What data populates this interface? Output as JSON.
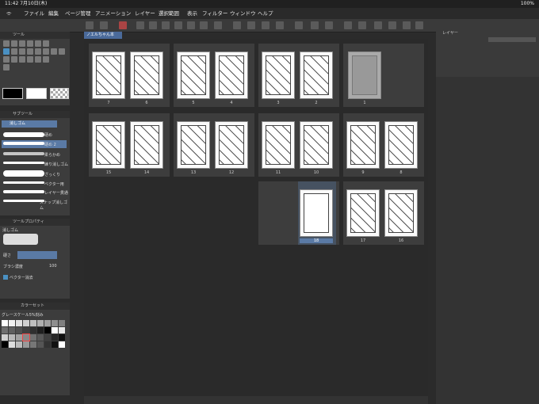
{
  "status": {
    "time": "11:42",
    "date": "7月10日(木)",
    "battery": "100%"
  },
  "menu": [
    "ファイル",
    "編集",
    "ページ管理",
    "アニメーション",
    "レイヤー",
    "選択範囲",
    "表示",
    "フィルター",
    "ウィンドウ",
    "ヘルプ"
  ],
  "panels": {
    "tool": "ツール",
    "subtool": "サブツール",
    "subtool_group": "消しゴム",
    "erasers": [
      "硬め",
      "硬め 2",
      "柔らかめ",
      "練り消しゴム",
      "ざっくり",
      "ベクター用",
      "レイヤー貫通",
      "スナップ消しゴム"
    ],
    "toolprop": "ツールプロパティ",
    "tp_name": "消しゴム",
    "tp_hardness": "硬さ",
    "tp_brush_density": "ブラシ濃度",
    "tp_density_value": "100",
    "tp_vector": "ベクター消去",
    "colorset": "カラーセット",
    "colorset_name": "グレースケール5%刻み",
    "layer": "レイヤー"
  },
  "document": {
    "tab": "ノエルちゃん本"
  },
  "pages": [
    "7",
    "6",
    "5",
    "4",
    "3",
    "2",
    "1",
    "15",
    "14",
    "13",
    "12",
    "11",
    "10",
    "9",
    "8",
    "18",
    "17",
    "16"
  ],
  "colors": {
    "accent": "#4a6a9a",
    "panel": "#3c3c3c"
  }
}
